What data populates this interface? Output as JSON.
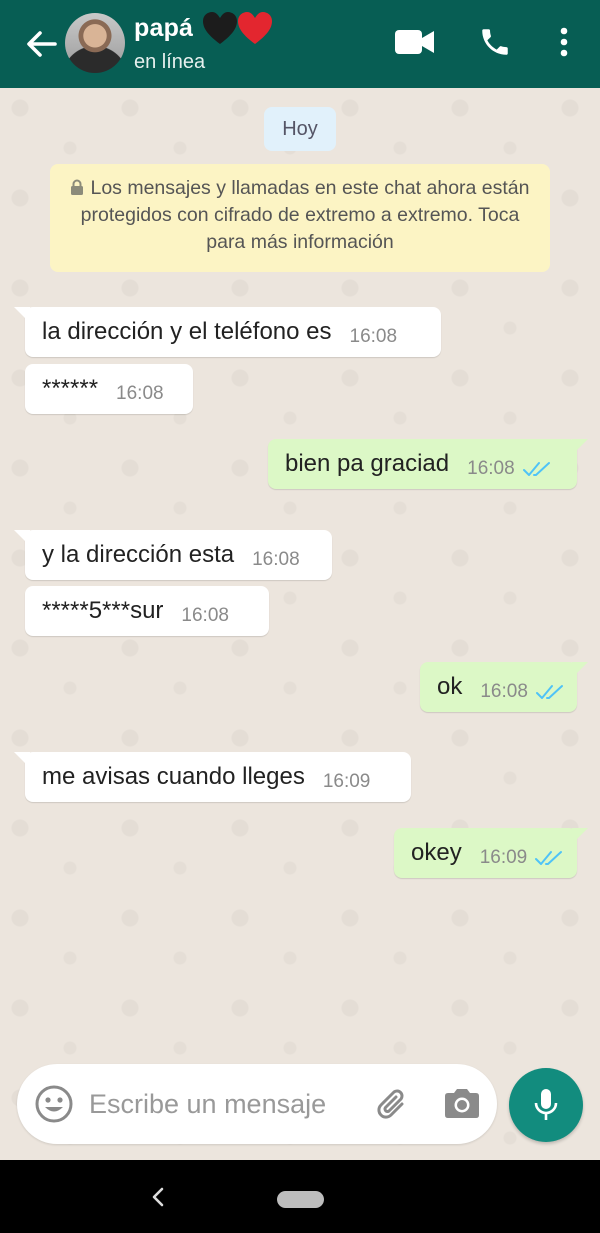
{
  "header": {
    "contact_name": "papá",
    "status": "en línea",
    "hearts": [
      "black-heart",
      "red-heart"
    ],
    "icons": [
      "back-arrow-icon",
      "video-call-icon",
      "phone-icon",
      "more-vert-icon"
    ],
    "background_color": "#075e54"
  },
  "chat": {
    "date_label": "Hoy",
    "encryption_notice": "Los mensajes y llamadas en este chat ahora están protegidos con cifrado de extremo a extremo. Toca para más información",
    "messages": [
      {
        "direction": "in",
        "text": "la dirección y el teléfono es",
        "time": "16:08"
      },
      {
        "direction": "in",
        "text": "******",
        "time": "16:08"
      },
      {
        "direction": "out",
        "text": "bien pa graciad",
        "time": "16:08",
        "status": "read"
      },
      {
        "direction": "in",
        "text": "y la dirección esta",
        "time": "16:08"
      },
      {
        "direction": "in",
        "text": "*****5***sur",
        "time": "16:08"
      },
      {
        "direction": "out",
        "text": "ok",
        "time": "16:08",
        "status": "read"
      },
      {
        "direction": "in",
        "text": "me avisas cuando lleges",
        "time": "16:09"
      },
      {
        "direction": "out",
        "text": "okey",
        "time": "16:09",
        "status": "read"
      }
    ],
    "colors": {
      "incoming": "#ffffff",
      "outgoing": "#dcf8c6",
      "read_ticks": "#4fc3f7"
    }
  },
  "composer": {
    "placeholder": "Escribe un mensaje",
    "value": "",
    "icons": [
      "emoji-icon",
      "attach-icon",
      "camera-icon",
      "mic-icon"
    ],
    "mic_color": "#128c7e"
  },
  "navbar": {
    "icons": [
      "nav-back-icon",
      "nav-home-pill"
    ]
  }
}
